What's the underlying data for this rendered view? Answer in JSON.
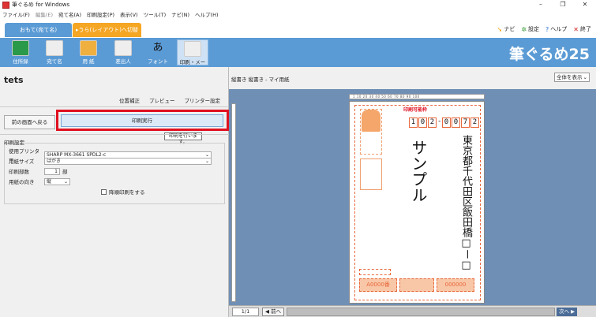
{
  "window": {
    "title": "筆ぐるめ for Windows",
    "controls": [
      "–",
      "❐",
      "✕"
    ]
  },
  "menu": [
    {
      "label": "ファイル(F)",
      "dim": false
    },
    {
      "label": "編集(E)",
      "dim": true
    },
    {
      "label": "宛て名(A)",
      "dim": false
    },
    {
      "label": "印刷設定(P)",
      "dim": false
    },
    {
      "label": "表示(V)",
      "dim": false
    },
    {
      "label": "ツール(T)",
      "dim": false
    },
    {
      "label": "ナビ(N)",
      "dim": false
    },
    {
      "label": "ヘルプ(H)",
      "dim": false
    }
  ],
  "tabs": {
    "omote": "おもて(宛て名)",
    "ura": "▸うら(レイアウト)へ切替"
  },
  "topright": {
    "navi": "ナビ",
    "settings": "設定",
    "help": "ヘルプ",
    "exit": "終了"
  },
  "toolbar": {
    "items": [
      "住所録",
      "宛て名",
      "用 紙",
      "差出人",
      "フォント",
      "印刷・メール"
    ],
    "brand": "筆ぐるめ25"
  },
  "left": {
    "doc_title": "tets",
    "links": [
      "位置補正",
      "プレビュー",
      "プリンター設定"
    ],
    "back_button": "前の画面へ戻る",
    "exec_button": "印刷実行",
    "tooltip": "印刷を行います。",
    "settings": {
      "legend": "印刷設定",
      "printer_label": "使用プリンター",
      "printer_value": "SHARP MX-3661 SPDL2-c",
      "paper_label": "用紙サイズ",
      "paper_value": "はがき",
      "copies_label": "印刷部数",
      "copies_value": "1",
      "copies_unit": "部",
      "orient_label": "用紙の向き",
      "orient_value": "縦",
      "reverse_label": "降順印刷をする"
    }
  },
  "right": {
    "paper_label": "縦書き 縦書き - マイ用紙",
    "zoom_value": "全体を表示",
    "ruler_text": "1  10  20  30  40  50  60  70  80  90  100",
    "postcard": {
      "print_area_label": "印刷可能枠",
      "zip": [
        "1",
        "0",
        "2",
        "-",
        "0",
        "0",
        "7",
        "2"
      ],
      "address": "東京都千代田区飯田橋□ー□",
      "name": "サンプル",
      "box1": "A0000番",
      "box2": "000000"
    },
    "status": {
      "page": "1/1",
      "prev": "前へ",
      "next": "次へ ▶"
    }
  }
}
